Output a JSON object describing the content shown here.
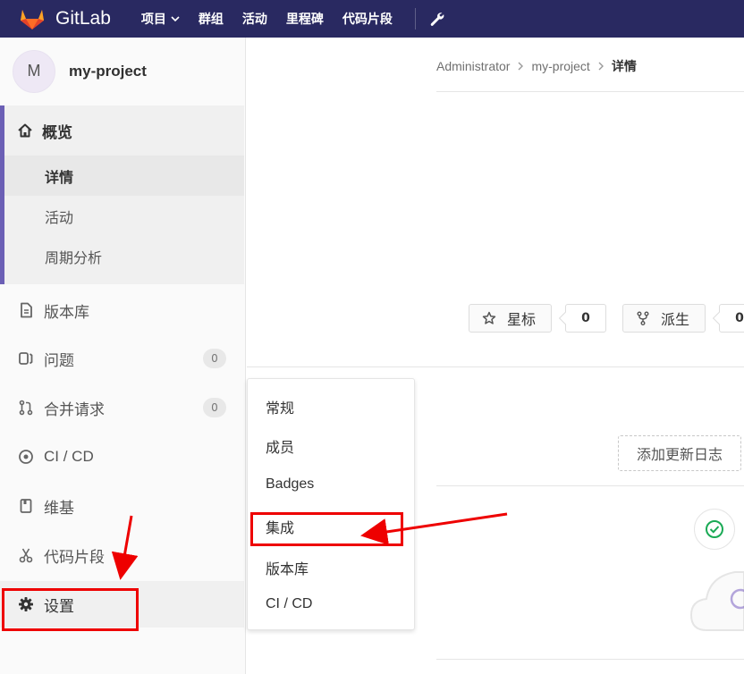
{
  "navbar": {
    "brand": "GitLab",
    "links": [
      {
        "label": "项目",
        "has_caret": true
      },
      {
        "label": "群组"
      },
      {
        "label": "活动"
      },
      {
        "label": "里程碑"
      },
      {
        "label": "代码片段"
      }
    ],
    "admin_icon": "wrench-icon"
  },
  "sidebar": {
    "avatar_letter": "M",
    "project_name": "my-project",
    "overview": {
      "label": "概览",
      "icon": "home-icon",
      "items": [
        "详情",
        "活动",
        "周期分析"
      ],
      "active_item": "详情"
    },
    "items": [
      {
        "label": "版本库",
        "icon": "document-icon"
      },
      {
        "label": "问题",
        "icon": "issues-icon",
        "count": "0"
      },
      {
        "label": "合并请求",
        "icon": "merge-request-icon",
        "count": "0"
      },
      {
        "label": "CI / CD",
        "icon": "rocket-icon"
      },
      {
        "label": "维基",
        "icon": "book-icon"
      },
      {
        "label": "代码片段",
        "icon": "scissors-icon"
      },
      {
        "label": "设置",
        "icon": "gear-icon"
      }
    ]
  },
  "breadcrumb": {
    "items": [
      "Administrator",
      "my-project",
      "详情"
    ]
  },
  "actions": {
    "star": {
      "label": "星标",
      "count": "0",
      "icon": "star-icon"
    },
    "fork": {
      "label": "派生",
      "count": "0",
      "icon": "fork-icon"
    }
  },
  "changelog_button": "添加更新日志",
  "settings_menu": {
    "items": [
      "常规",
      "成员",
      "Badges",
      "集成",
      "版本库",
      "CI / CD"
    ]
  },
  "colors": {
    "navbar": "#292961",
    "active_border": "#6b5fb5",
    "annotation": "#ee0000",
    "success": "#1aaa55"
  }
}
